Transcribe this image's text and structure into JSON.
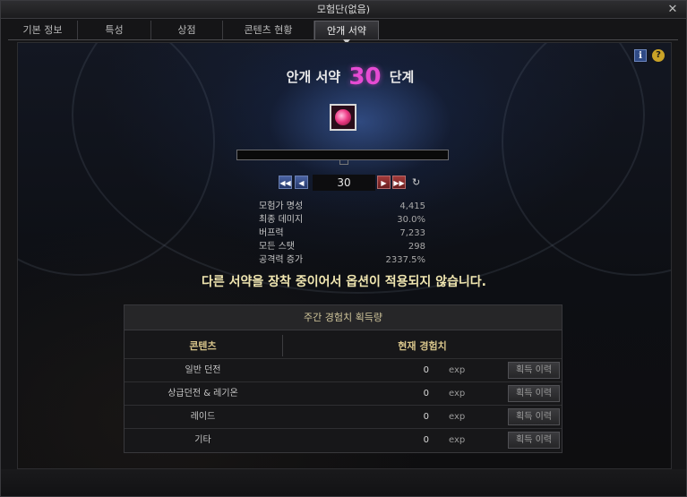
{
  "window": {
    "title": "모험단(없음)",
    "close_label": "✕"
  },
  "tabs": [
    {
      "label": "기본 정보",
      "active": false
    },
    {
      "label": "특성",
      "active": false
    },
    {
      "label": "상점",
      "active": false
    },
    {
      "label": "콘텐츠 현황",
      "active": false
    },
    {
      "label": "안개 서약",
      "active": true
    }
  ],
  "icons": {
    "info": "i",
    "help": "?",
    "refresh": "↻",
    "first": "◀◀",
    "prev": "◀",
    "next": "▶",
    "last": "▶▶"
  },
  "pact": {
    "title_prefix": "안개 서약",
    "level": "30",
    "title_suffix": "단계",
    "level_color": "#e64bd3",
    "progress": 0
  },
  "stepper": {
    "value": "30"
  },
  "stats": [
    {
      "label": "모험가 명성",
      "value": "4,415"
    },
    {
      "label": "최종 데미지",
      "value": "30.0%"
    },
    {
      "label": "버프력",
      "value": "7,233"
    },
    {
      "label": "모든 스탯",
      "value": "298"
    },
    {
      "label": "공격력 증가",
      "value": "2337.5%"
    }
  ],
  "warning": "다른 서약을 장착 중이어서 옵션이 적용되지 않습니다.",
  "exp_table": {
    "title": "주간 경험치 획득량",
    "headers": {
      "content": "콘텐츠",
      "current": "현재 경험치"
    },
    "rows": [
      {
        "name": "일반 던전",
        "value": "0",
        "unit": "exp",
        "button": "획득 이력"
      },
      {
        "name": "상급던전 & 레기온",
        "value": "0",
        "unit": "exp",
        "button": "획득 이력"
      },
      {
        "name": "레이드",
        "value": "0",
        "unit": "exp",
        "button": "획득 이력"
      },
      {
        "name": "기타",
        "value": "0",
        "unit": "exp",
        "button": "획득 이력"
      }
    ]
  }
}
